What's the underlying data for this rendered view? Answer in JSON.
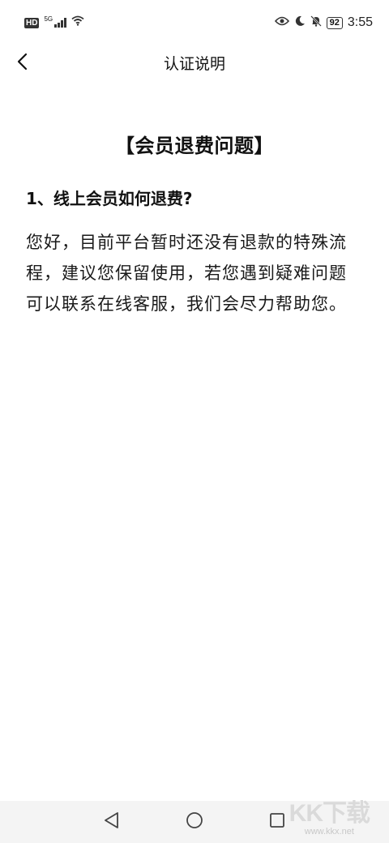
{
  "status_bar": {
    "hd_label": "HD",
    "network_label": "5G",
    "battery_level": "92",
    "time": "3:55",
    "icons": [
      "hd-icon",
      "signal-icon",
      "wifi-icon",
      "eye-icon",
      "moon-icon",
      "bell-off-icon",
      "battery-icon"
    ]
  },
  "header": {
    "title": "认证说明",
    "back_icon": "chevron-left-icon"
  },
  "content": {
    "section_title": "【会员退费问题】",
    "question": "1、线上会员如何退费?",
    "answer": "您好，目前平台暂时还没有退款的特殊流程，建议您保留使用，若您遇到疑难问题可以联系在线客服，我们会尽力帮助您。"
  },
  "nav_bar": {
    "icons": [
      "back-triangle-icon",
      "home-circle-icon",
      "recents-square-icon"
    ]
  },
  "watermark": {
    "logo": "KK下载",
    "url": "www.kkx.net"
  }
}
